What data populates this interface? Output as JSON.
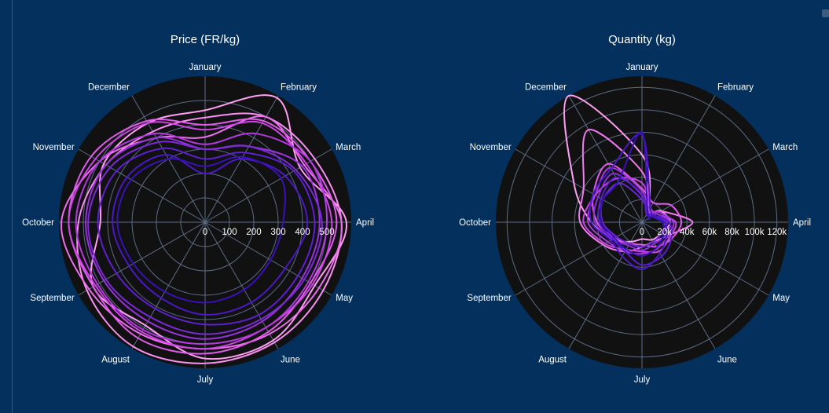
{
  "colors": {
    "background": "#03305c",
    "polar_background": "#111111",
    "grid": "#5d6c86",
    "text": "#ffffff"
  },
  "chart_data": [
    {
      "type": "polar-line",
      "title": "Price (FR/kg)",
      "theta_labels": [
        "January",
        "February",
        "March",
        "April",
        "May",
        "June",
        "July",
        "August",
        "September",
        "October",
        "November",
        "December"
      ],
      "radial_ticks": [
        0,
        100,
        200,
        300,
        400,
        500
      ],
      "radial_tick_labels": [
        "0",
        "100",
        "200",
        "300",
        "400",
        "500"
      ],
      "radial_range": [
        0,
        600
      ],
      "series": [
        {
          "color": "#ff9ff3",
          "values": [
            460,
            590,
            450,
            580,
            520,
            560,
            560,
            490,
            530,
            430,
            480,
            470
          ]
        },
        {
          "color": "#f98ff0",
          "values": [
            430,
            500,
            520,
            560,
            560,
            570,
            580,
            590,
            560,
            520,
            470,
            430
          ]
        },
        {
          "color": "#ee6ef0",
          "values": [
            350,
            500,
            470,
            560,
            540,
            530,
            520,
            530,
            550,
            590,
            500,
            400
          ]
        },
        {
          "color": "#e05cec",
          "values": [
            400,
            480,
            500,
            540,
            500,
            520,
            540,
            550,
            530,
            560,
            540,
            480
          ]
        },
        {
          "color": "#cf44e6",
          "values": [
            380,
            470,
            480,
            520,
            510,
            500,
            520,
            520,
            520,
            560,
            520,
            470
          ]
        },
        {
          "color": "#b438e0",
          "values": [
            320,
            420,
            500,
            500,
            490,
            500,
            500,
            510,
            510,
            530,
            500,
            420
          ]
        },
        {
          "color": "#9a32de",
          "values": [
            300,
            360,
            460,
            470,
            460,
            470,
            480,
            470,
            480,
            490,
            470,
            400
          ]
        },
        {
          "color": "#7a2ad6",
          "values": [
            300,
            360,
            430,
            480,
            470,
            460,
            460,
            450,
            470,
            480,
            450,
            380
          ]
        },
        {
          "color": "#5e1fd0",
          "values": [
            260,
            330,
            420,
            450,
            440,
            440,
            420,
            410,
            420,
            440,
            420,
            350
          ]
        },
        {
          "color": "#4a18c6",
          "values": [
            200,
            300,
            380,
            420,
            380,
            380,
            380,
            360,
            360,
            380,
            370,
            320
          ]
        },
        {
          "color": "#3a10b8",
          "values": [
            230,
            310,
            360,
            320,
            310,
            320,
            330,
            330,
            340,
            360,
            350,
            300
          ]
        }
      ]
    },
    {
      "type": "polar-line",
      "title": "Quantity (kg)",
      "theta_labels": [
        "January",
        "February",
        "March",
        "April",
        "May",
        "June",
        "July",
        "August",
        "September",
        "October",
        "November",
        "December"
      ],
      "radial_ticks": [
        0,
        20000,
        40000,
        60000,
        80000,
        100000,
        120000
      ],
      "radial_tick_labels": [
        "0",
        "20k",
        "40k",
        "60k",
        "80k",
        "100k",
        "120k"
      ],
      "radial_range": [
        0,
        130000
      ],
      "series": [
        {
          "color": "#ff9ff3",
          "values": [
            60000,
            15000,
            20000,
            25000,
            20000,
            18000,
            15000,
            20000,
            30000,
            45000,
            70000,
            130000
          ]
        },
        {
          "color": "#f07af0",
          "values": [
            45000,
            12000,
            20000,
            45000,
            25000,
            20000,
            22000,
            30000,
            40000,
            55000,
            60000,
            95000
          ]
        },
        {
          "color": "#e05cec",
          "values": [
            30000,
            20000,
            30000,
            35000,
            30000,
            25000,
            20000,
            22000,
            28000,
            40000,
            50000,
            60000
          ]
        },
        {
          "color": "#c946e6",
          "values": [
            35000,
            15000,
            15000,
            30000,
            28000,
            30000,
            26000,
            28000,
            38000,
            52000,
            48000,
            45000
          ]
        },
        {
          "color": "#a83ae0",
          "values": [
            28000,
            12000,
            18000,
            28000,
            26000,
            27000,
            28000,
            30000,
            35000,
            48000,
            48000,
            56000
          ]
        },
        {
          "color": "#8a2ede",
          "values": [
            24000,
            10000,
            15000,
            25000,
            24000,
            22000,
            25000,
            24000,
            30000,
            42000,
            45000,
            50000
          ]
        },
        {
          "color": "#6c26d6",
          "values": [
            20000,
            10000,
            12000,
            22000,
            20000,
            20000,
            22000,
            22000,
            26000,
            35000,
            40000,
            40000
          ]
        },
        {
          "color": "#5a1dd0",
          "values": [
            25000,
            8000,
            12000,
            24000,
            30000,
            35000,
            38000,
            30000,
            30000,
            38000,
            42000,
            46000
          ]
        },
        {
          "color": "#4a18c6",
          "values": [
            78000,
            15000,
            12000,
            20000,
            25000,
            32000,
            42000,
            35000,
            32000,
            45000,
            50000,
            55000
          ]
        },
        {
          "color": "#3a10b8",
          "values": [
            80000,
            10000,
            10000,
            18000,
            22000,
            26000,
            30000,
            28000,
            28000,
            36000,
            40000,
            42000
          ]
        }
      ]
    }
  ]
}
